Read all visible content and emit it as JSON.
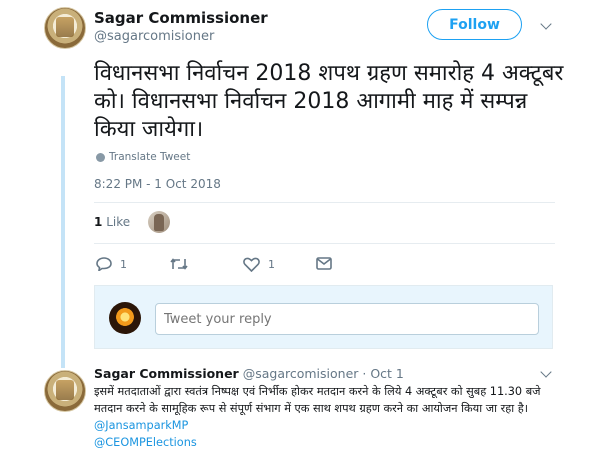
{
  "tweet": {
    "author_name": "Sagar Commissioner",
    "author_handle": "@sagarcomisioner",
    "follow_label": "Follow",
    "text": "विधानसभा निर्वाचन 2018 शपथ ग्रहण समारोह 4 अक्टूबर को। विधानसभा निर्वाचन 2018 आगामी माह में सम्पन्न किया जायेगा।",
    "translate_label": "Translate Tweet",
    "timestamp": "8:22 PM - 1 Oct 2018",
    "likes_count": "1",
    "likes_label": "Like",
    "reply_count": "1",
    "like_action_count": "1"
  },
  "reply_box": {
    "placeholder": "Tweet your reply"
  },
  "reply_tweet": {
    "author_name": "Sagar Commissioner",
    "author_handle": "@sagarcomisioner",
    "date": "· Oct 1",
    "text": "इसमें मतदाताओं द्वारा स्वतंत्र निष्पक्ष एवं निर्भीक होकर मतदान करने के लिये 4 अक्टूबर को सुबह 11.30 बजे मतदान करने के सामूहिक रूप से संपूर्ण संभाग में एक साथ शपथ ग्रहण करने का आयोजन किया जा रहा है।",
    "mention_1": "@JansamparkMP",
    "mention_2": "@CEOMPElections"
  },
  "colors": {
    "accent": "#1da1f2",
    "reply_box_bg": "#e8f5fd",
    "thread_line": "#c4e3f7"
  },
  "icons": [
    "reply-icon",
    "retweet-icon",
    "heart-icon",
    "message-icon",
    "globe-icon",
    "chevron-down-icon"
  ]
}
